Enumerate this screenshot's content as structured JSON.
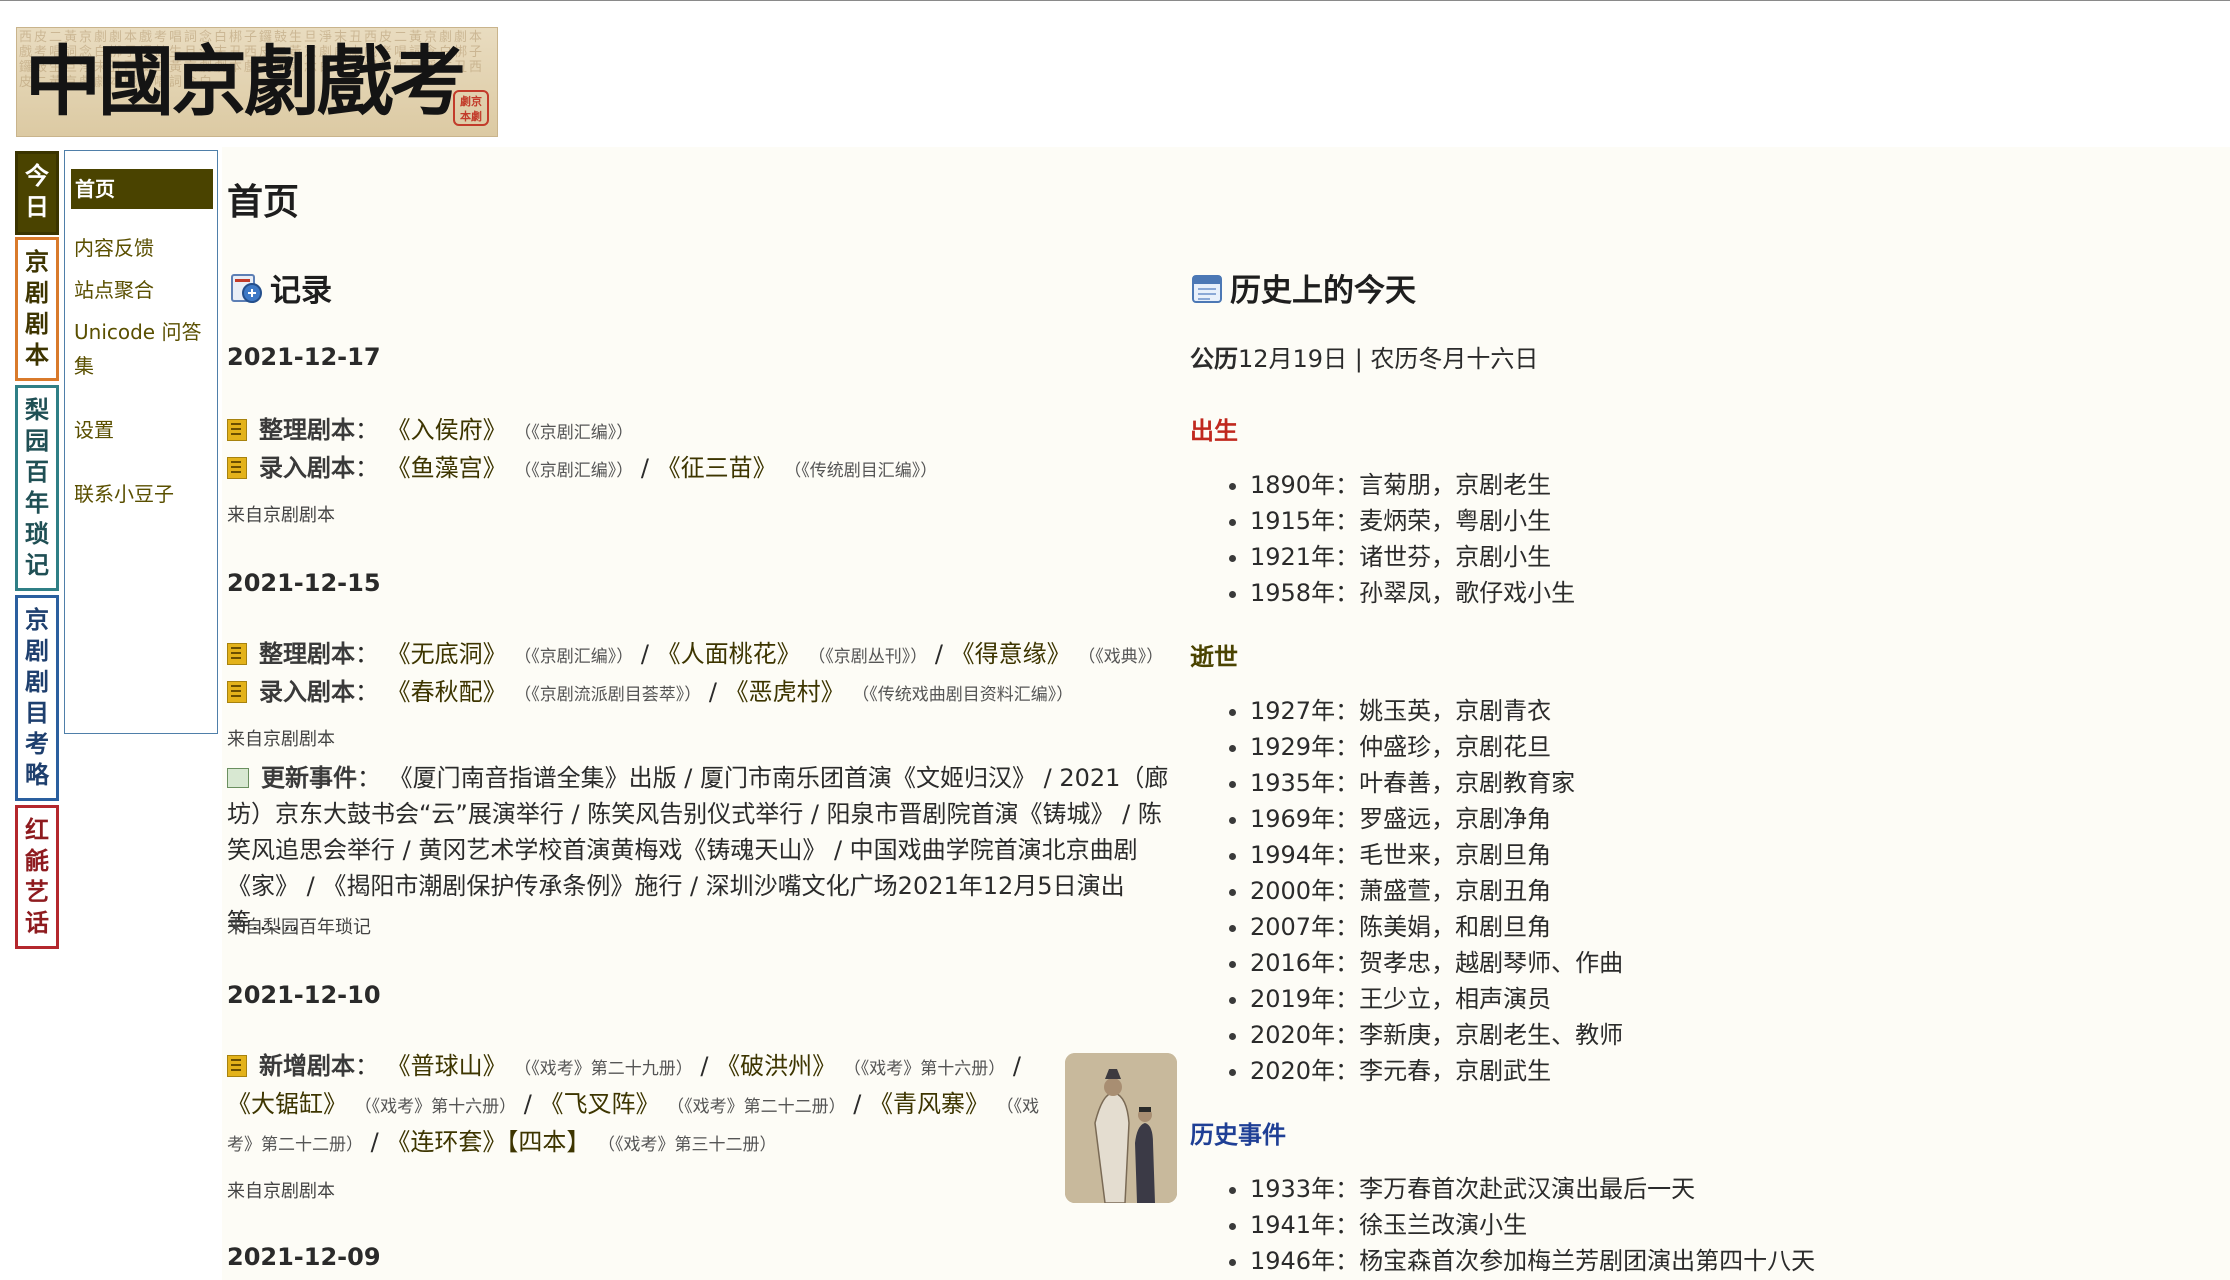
{
  "logo": {
    "title": "中國京劇戲考",
    "seal": "劇京本劇",
    "background_text": "西皮二黃京劇劇本戲考唱詞念白梆子鑼鼓生旦淨末丑西皮二黃京劇劇本戲考唱詞念白梆子鑼鼓生旦淨末丑西皮二黃京劇劇本戲考唱詞念白梆子鑼鼓生旦淨末丑西皮二黃京劇劇本戲考唱詞念白梆子鑼鼓生旦淨末丑西皮二黃京劇劇本戲考唱詞念白"
  },
  "vtabs": [
    {
      "label": "今日"
    },
    {
      "label": "京剧剧本"
    },
    {
      "label": "梨园百年琐记"
    },
    {
      "label": "京剧剧目考略"
    },
    {
      "label": "红毹艺话"
    }
  ],
  "sidemenu": {
    "header": "首页",
    "items": [
      "内容反馈",
      "站点聚合",
      "Unicode 问答",
      "集",
      "设置",
      "联系小豆子"
    ]
  },
  "main": {
    "title": "首页",
    "records_heading": "记录",
    "history_heading": "历史上的今天"
  },
  "records": {
    "d1": {
      "date": "2021-12-17",
      "l1_label": "整理剧本",
      "l1_w1": "《入侯府》",
      "l1_s1": "（《京剧汇编》）",
      "l2_label": "录入剧本",
      "l2_w1": "《鱼藻宫》",
      "l2_s1": "（《京剧汇编》）",
      "l2_w2": "《征三苗》",
      "l2_s2": "（《传统剧目汇编》）",
      "from": "来自京剧剧本"
    },
    "d2": {
      "date": "2021-12-15",
      "l1_label": "整理剧本",
      "l1_w1": "《无底洞》",
      "l1_s1": "（《京剧汇编》）",
      "l1_w2": "《人面桃花》",
      "l1_s2": "（《京剧丛刊》）",
      "l1_w3": "《得意缘》",
      "l1_s3": "（《戏典》）",
      "l2_label": "录入剧本",
      "l2_w1": "《春秋配》",
      "l2_s1": "（《京剧流派剧目荟萃》）",
      "l2_w2": "《恶虎村》",
      "l2_s2": "（《传统戏曲剧目资料汇编》）",
      "from": "来自京剧剧本",
      "events_label": "更新事件",
      "events_text": "《厦门南音指谱全集》出版 / 厦门市南乐团首演《文姬归汉》 / 2021（廊坊）京东大鼓书会“云”展演举行 / 陈笑风告别仪式举行 / 阳泉市晋剧院首演《铸城》 / 陈笑风追思会举行 / 黄冈艺术学校首演黄梅戏《铸魂天山》 / 中国戏曲学院首演北京曲剧《家》 / 《揭阳市潮剧保护传承条例》施行 / 深圳沙嘴文化广场2021年12月5日演出 等……",
      "from2": "来自梨园百年琐记"
    },
    "d3": {
      "date": "2021-12-10",
      "label": "新增剧本",
      "w1": "《普球山》",
      "s1": "（《戏考》第二十九册）",
      "w2": "《破洪州》",
      "s2": "（《戏考》第十六册）",
      "w3": "《大锯缸》",
      "s3": "（《戏考》第十六册）",
      "w4": "《飞叉阵》",
      "s4": "（《戏考》第二十二册）",
      "w5": "《青风寨》",
      "s5a": "（《戏",
      "s5b": "考》第二十二册）",
      "w6": "《连环套》【四本】",
      "s6": "（《戏考》第三十二册）",
      "from": "来自京剧剧本"
    },
    "d4": {
      "date": "2021-12-09"
    }
  },
  "history": {
    "calendar_label": "公历",
    "calendar_text": "12月19日 | 农历冬月十六日",
    "births_heading": "出生",
    "births": [
      "1890年：言菊朋，京剧老生",
      "1915年：麦炳荣，粤剧小生",
      "1921年：诸世芬，京剧小生",
      "1958年：孙翠凤，歌仔戏小生"
    ],
    "deaths_heading": "逝世",
    "deaths": [
      "1927年：姚玉英，京剧青衣",
      "1929年：仲盛珍，京剧花旦",
      "1935年：叶春善，京剧教育家",
      "1969年：罗盛远，京剧净角",
      "1994年：毛世来，京剧旦角",
      "2000年：萧盛萱，京剧丑角",
      "2007年：陈美娟，和剧旦角",
      "2016年：贺孝忠，越剧琴师、作曲",
      "2019年：王少立，相声演员",
      "2020年：李新庚，京剧老生、教师",
      "2020年：李元春，京剧武生"
    ],
    "events_heading": "历史事件",
    "events": [
      "1933年：李万春首次赴武汉演出最后一天",
      "1941年：徐玉兰改演小生",
      "1946年：杨宝森首次参加梅兰芳剧团演出第四十八天"
    ]
  },
  "colors": {
    "olive": "#4a4300",
    "births": "#c0281e",
    "deaths": "#4a4300",
    "events": "#1f3f95"
  }
}
